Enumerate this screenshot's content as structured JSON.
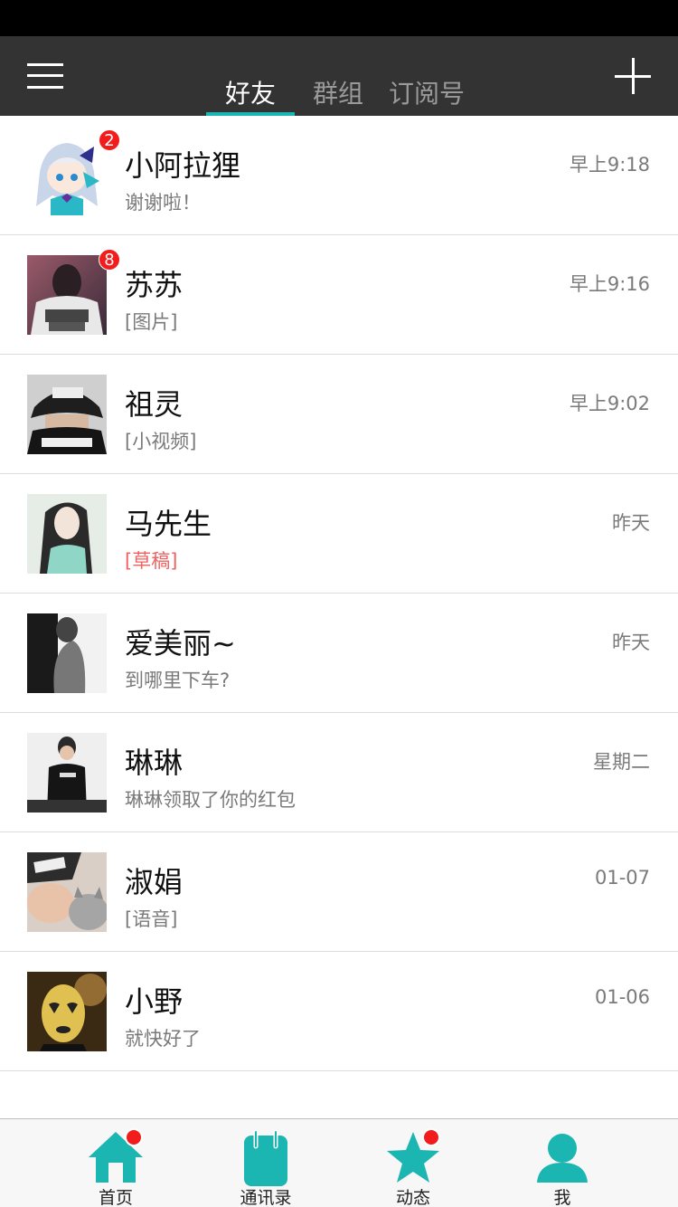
{
  "header": {
    "tabs": [
      {
        "label": "好友",
        "active": true
      },
      {
        "label": "群组",
        "active": false
      },
      {
        "label": "订阅号",
        "active": false
      }
    ],
    "menu_icon": "hamburger-menu-icon",
    "add_icon": "plus-icon"
  },
  "conversations": [
    {
      "name": "小阿拉狸",
      "preview": "谢谢啦！",
      "time": "早上9:18",
      "badge": "2",
      "avatar": "anime-girl-avatar"
    },
    {
      "name": "苏苏",
      "preview": "[图片]",
      "time": "早上9:16",
      "badge": "8",
      "avatar": "mlgb-shirt-avatar"
    },
    {
      "name": "祖灵",
      "preview": "[小视频]",
      "time": "早上9:02",
      "badge": "",
      "avatar": "dope-cap-avatar"
    },
    {
      "name": "马先生",
      "preview": "[草稿]",
      "time": "昨天",
      "badge": "",
      "avatar": "long-hair-girl-avatar"
    },
    {
      "name": "爱美丽~",
      "preview": "到哪里下车?",
      "time": "昨天",
      "badge": "",
      "avatar": "bw-portrait-avatar"
    },
    {
      "name": "琳琳",
      "preview": "琳琳领取了你的红包",
      "time": "星期二",
      "badge": "",
      "avatar": "standing-man-avatar"
    },
    {
      "name": "淑娟",
      "preview": "[语音]",
      "time": "01-07",
      "badge": "",
      "avatar": "cap-and-cat-avatar"
    },
    {
      "name": "小野",
      "preview": "就快好了",
      "time": "01-06",
      "badge": "",
      "avatar": "noface-mask-avatar"
    }
  ],
  "bottom_nav": [
    {
      "label": "首页",
      "icon": "home-icon",
      "dot": true
    },
    {
      "label": "通讯录",
      "icon": "contacts-icon",
      "dot": false
    },
    {
      "label": "动态",
      "icon": "star-icon",
      "dot": true
    },
    {
      "label": "我",
      "icon": "person-icon",
      "dot": false
    }
  ],
  "colors": {
    "accent": "#1bb5b2",
    "header_bg": "#333333",
    "badge": "#f21c1c",
    "draft_text": "#f06262"
  }
}
